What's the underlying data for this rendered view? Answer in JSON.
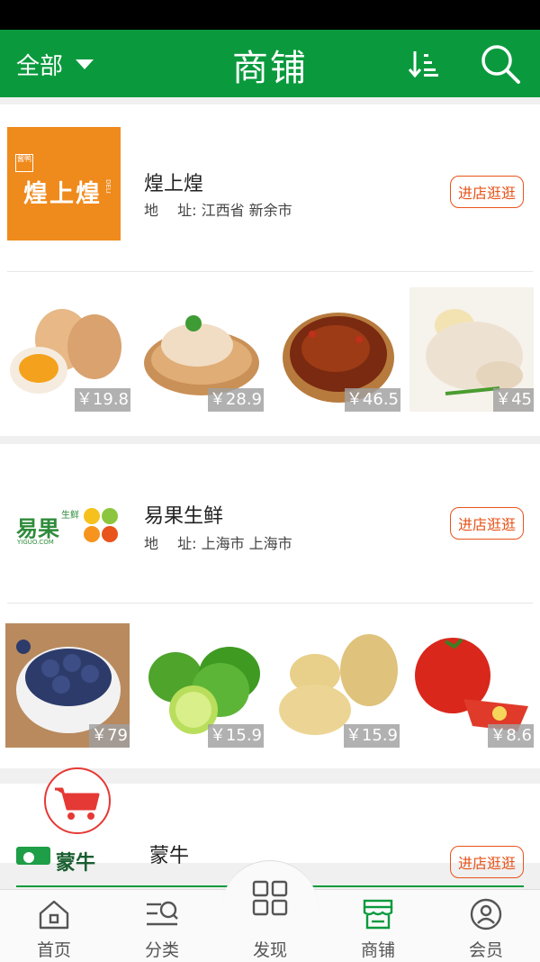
{
  "header": {
    "filter_label": "全部",
    "title": "商铺",
    "sort_icon": "sort-icon",
    "search_icon": "search-icon"
  },
  "shops": [
    {
      "name": "煌上煌",
      "address_label": "地　 址:",
      "address": "江西省 新余市",
      "visit_label": "进店逛逛",
      "logo_text": "煌上煌",
      "logo_sub": "DELI",
      "logo_stamp": "酱鸭",
      "products": [
        {
          "price": "￥19.8",
          "item": "eggs"
        },
        {
          "price": "￥28.9",
          "item": "chicken"
        },
        {
          "price": "￥46.5",
          "item": "braised-duck"
        },
        {
          "price": "￥45",
          "item": "whole-chicken"
        }
      ]
    },
    {
      "name": "易果生鲜",
      "address_label": "地　 址:",
      "address": "上海市 上海市",
      "visit_label": "进店逛逛",
      "logo_text": "易果",
      "logo_sub_cn": "生鲜",
      "logo_sub_en": "YIGUO.COM",
      "products": [
        {
          "price": "￥79",
          "item": "blueberries"
        },
        {
          "price": "￥15.9",
          "item": "limes"
        },
        {
          "price": "￥15.9",
          "item": "potatoes"
        },
        {
          "price": "￥8.6",
          "item": "tomatoes"
        }
      ]
    },
    {
      "name": "蒙牛",
      "visit_label": "进店逛逛",
      "logo_text": "蒙牛"
    }
  ],
  "tabs": [
    {
      "label": "首页",
      "icon": "home-icon"
    },
    {
      "label": "分类",
      "icon": "category-icon"
    },
    {
      "label": "发现",
      "icon": "discover-icon"
    },
    {
      "label": "商铺",
      "icon": "shop-icon",
      "active": true
    },
    {
      "label": "会员",
      "icon": "member-icon"
    }
  ],
  "colors": {
    "brand_green": "#0a9a3d",
    "accent_orange": "#e8541b",
    "cart_red": "#e53935"
  }
}
